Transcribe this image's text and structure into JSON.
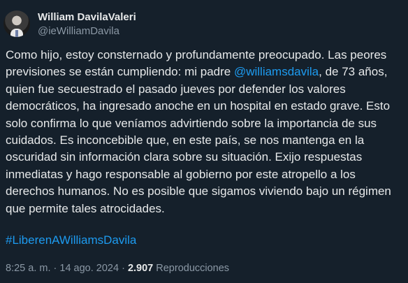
{
  "author": {
    "display_name": "William DavilaValeri",
    "handle": "@ieWilliamDavila"
  },
  "tweet": {
    "lines": [
      {
        "text": "Como hijo, estoy consternado y profundamente preocupado. Las peores"
      },
      {
        "before": "previsiones se están cumpliendo: mi padre ",
        "mention": "@williamsdavila",
        "after": ", de 73 años,"
      },
      {
        "text": "quien fue secuestrado el pasado jueves por defender los valores"
      },
      {
        "text": "democráticos, ha ingresado anoche en un hospital en estado grave. Esto"
      },
      {
        "text": "solo confirma lo que veníamos advirtiendo sobre la importancia de sus"
      },
      {
        "text": "cuidados. Es inconcebible que, en este país, se nos mantenga en la"
      },
      {
        "text": "oscuridad sin información clara sobre su situación. Exijo respuestas"
      },
      {
        "text": "inmediatas y hago responsable al gobierno por este atropello a los"
      },
      {
        "text": "derechos humanos. No es posible que sigamos viviendo bajo un régimen"
      },
      {
        "text": "que permite tales atrocidades."
      }
    ],
    "hashtag": "#LiberenAWilliamsDavila"
  },
  "meta": {
    "time": "8:25 a. m.",
    "separator": " · ",
    "date": "14 ago. 2024",
    "views_count": "2.907",
    "views_label": " Reproducciones"
  },
  "colors": {
    "background": "#15202b",
    "link": "#1d9bf0",
    "secondary_text": "#8b98a5",
    "primary_text": "#e7e9ea"
  }
}
